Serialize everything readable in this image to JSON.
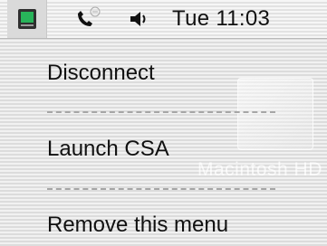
{
  "menubar": {
    "extras": [
      {
        "icon": "modem-status-icon",
        "active": true
      },
      {
        "icon": "phone-icon",
        "active": false
      },
      {
        "icon": "speaker-volume-icon",
        "active": false
      }
    ],
    "clock": "Tue 11:03"
  },
  "menu": {
    "items": [
      "Disconnect",
      "Launch CSA",
      "Remove this menu"
    ]
  },
  "desktop": {
    "drive_label": "Macintosh HD"
  }
}
